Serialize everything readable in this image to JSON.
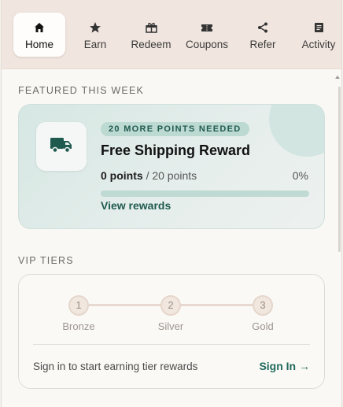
{
  "nav": {
    "tabs": [
      {
        "label": "Home",
        "icon": "home-icon",
        "active": true
      },
      {
        "label": "Earn",
        "icon": "star-icon",
        "active": false
      },
      {
        "label": "Redeem",
        "icon": "gift-icon",
        "active": false
      },
      {
        "label": "Coupons",
        "icon": "coupon-icon",
        "active": false
      },
      {
        "label": "Refer",
        "icon": "share-icon",
        "active": false
      },
      {
        "label": "Activity",
        "icon": "activity-list-icon",
        "active": false
      }
    ]
  },
  "featured": {
    "section_title": "FEATURED THIS WEEK",
    "badge": "20 MORE POINTS NEEDED",
    "title": "Free Shipping Reward",
    "points_current": "0 points",
    "points_total": "/ 20 points",
    "percent": "0%",
    "progress": 0,
    "link": "View rewards",
    "icon": "truck-icon"
  },
  "vip": {
    "section_title": "VIP TIERS",
    "tiers": [
      {
        "number": "1",
        "name": "Bronze"
      },
      {
        "number": "2",
        "name": "Silver"
      },
      {
        "number": "3",
        "name": "Gold"
      }
    ],
    "signin_text": "Sign in to start earning tier rewards",
    "signin_link": "Sign In →"
  },
  "colors": {
    "accent": "#1f5a4f",
    "nav_bg": "#f1e6df",
    "feature_bg": "#d6e7e3"
  }
}
